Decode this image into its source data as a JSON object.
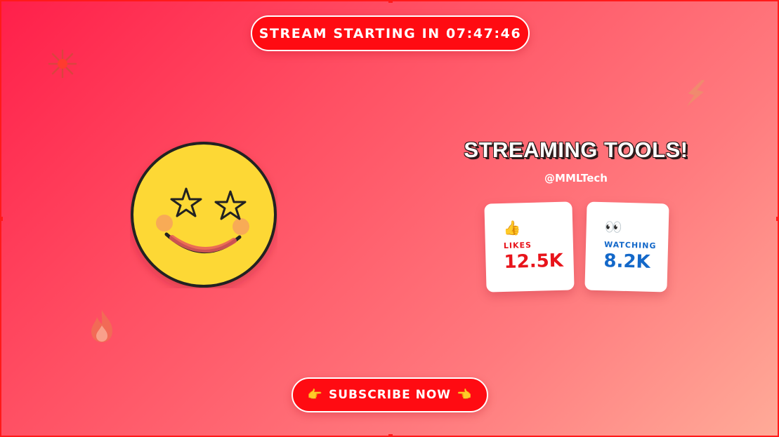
{
  "countdown": {
    "text": "STREAM STARTING IN 07:47:46"
  },
  "title": "STREAMING TOOLS!",
  "handle": "@MMLTech",
  "stats": [
    {
      "icon": "thumbs-up-icon",
      "emoji": "👍",
      "label": "LIKES",
      "value": "12.5K",
      "color": "#e8141b"
    },
    {
      "icon": "eyes-icon",
      "emoji": "👀",
      "label": "WATCHING",
      "value": "8.2K",
      "color": "#1368c9"
    }
  ],
  "subscribe": {
    "left_emoji": "👉",
    "label": "SUBSCRIBE NOW",
    "right_emoji": "👈"
  },
  "avatar": {
    "icon": "star-struck-smiley-icon"
  },
  "decorations": [
    "sparkle-icon",
    "lightning-icon",
    "fire-icon"
  ],
  "colors": {
    "accent": "#ff0b12",
    "likes": "#e8141b",
    "watching": "#1368c9",
    "face": "#fdd835"
  }
}
